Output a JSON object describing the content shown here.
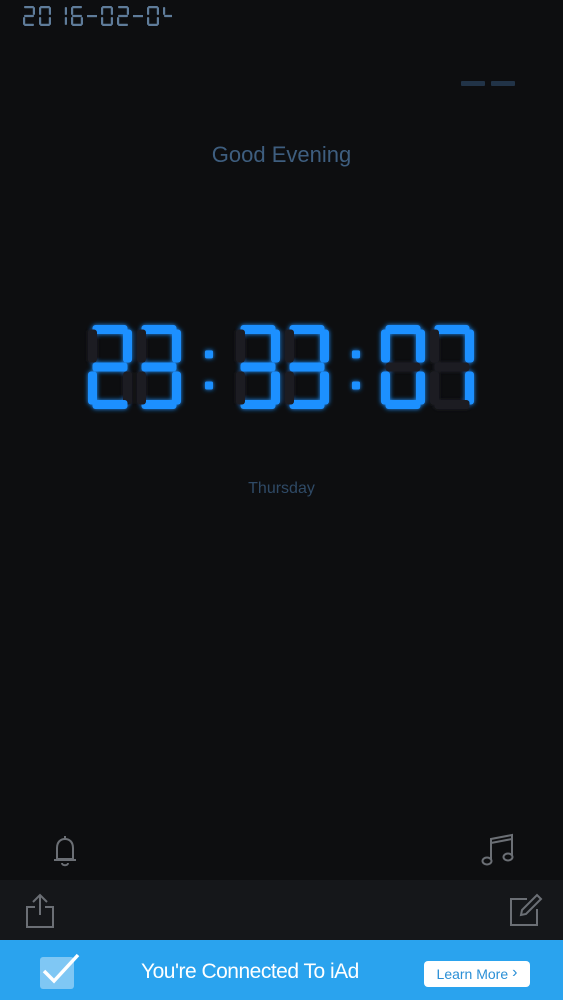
{
  "status": {
    "date": "2016-02-04"
  },
  "greeting": "Good Evening",
  "clock": {
    "time": "23:33:07",
    "hours": "23",
    "minutes": "33",
    "seconds": "07"
  },
  "weekday": "Thursday",
  "colors": {
    "background": "#0d0e10",
    "digit_on": "#1e90ff",
    "digit_off": "#1b1f24",
    "greeting": "#3e5e7f",
    "date_digits": "#5f7c9a",
    "toolbar": "#15171a",
    "ad_banner": "#2aa3ee"
  },
  "icons": {
    "alarm": "bell-icon",
    "music": "music-note-icon",
    "share": "share-icon",
    "edit": "edit-icon",
    "ad_check": "checkmark-icon"
  },
  "ad": {
    "message": "You're Connected To iAd",
    "button_label": "Learn More",
    "button_chevron": "›"
  }
}
